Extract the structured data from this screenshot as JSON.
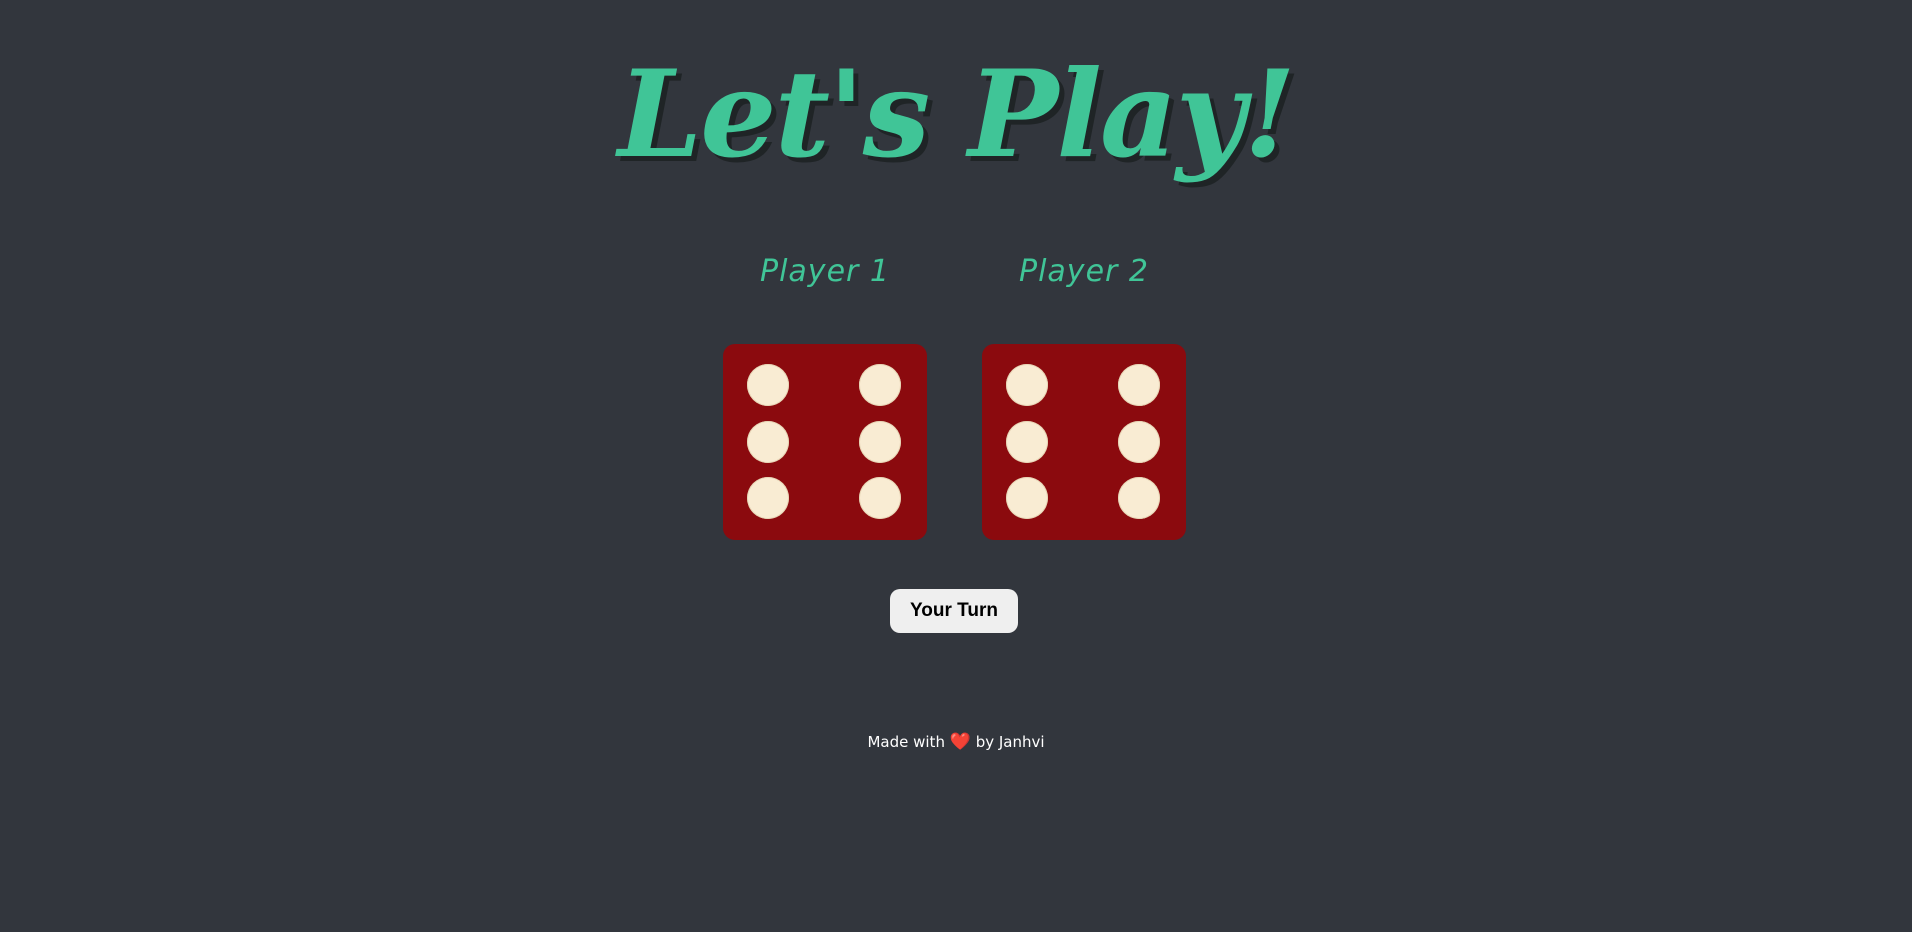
{
  "title": "Let's Play!",
  "players": [
    {
      "label": "Player 1",
      "die_value": 6
    },
    {
      "label": "Player 2",
      "die_value": 6
    }
  ],
  "turn_button_label": "Your Turn",
  "footer": {
    "prefix": "Made with",
    "heart": "❤️",
    "suffix": "by Janhvi"
  },
  "colors": {
    "background": "#32363d",
    "accent": "#40c597",
    "die": "#8b0a0e",
    "pip": "#f9ecd3"
  }
}
